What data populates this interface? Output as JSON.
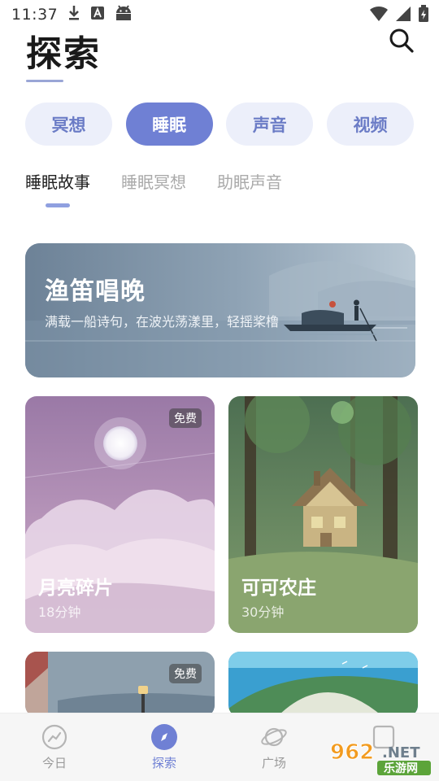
{
  "status_bar": {
    "time": "11:37",
    "icons": [
      "download-icon",
      "a-badge-icon",
      "android-icon",
      "wifi-icon",
      "signal-icon",
      "battery-icon"
    ]
  },
  "header": {
    "title": "探索",
    "search_icon": "search-icon"
  },
  "categories": [
    {
      "label": "冥想",
      "active": false
    },
    {
      "label": "睡眠",
      "active": true
    },
    {
      "label": "声音",
      "active": false
    },
    {
      "label": "视频",
      "active": false
    }
  ],
  "subtabs": [
    {
      "label": "睡眠故事",
      "active": true
    },
    {
      "label": "睡眠冥想",
      "active": false
    },
    {
      "label": "助眠声音",
      "active": false
    }
  ],
  "featured": {
    "title": "渔笛唱晚",
    "description": "满载一船诗句，在波光荡漾里，轻摇桨橹"
  },
  "cards": [
    {
      "title": "月亮碎片",
      "duration": "18分钟",
      "badge": "免费"
    },
    {
      "title": "可可农庄",
      "duration": "30分钟",
      "badge": ""
    },
    {
      "title": "",
      "duration": "",
      "badge": "免费"
    },
    {
      "title": "",
      "duration": "",
      "badge": ""
    }
  ],
  "bottom_nav": [
    {
      "label": "今日",
      "icon": "trend-chart-icon",
      "active": false
    },
    {
      "label": "探索",
      "icon": "compass-icon",
      "active": true
    },
    {
      "label": "广场",
      "icon": "planet-icon",
      "active": false
    },
    {
      "label": "",
      "icon": "profile-icon",
      "active": false
    }
  ],
  "watermark": {
    "number": "962",
    "suffix": ".NET",
    "text": "乐游网"
  },
  "colors": {
    "accent": "#6f80d4",
    "pill_bg": "#eceffa",
    "pill_text": "#6b7cc6"
  }
}
